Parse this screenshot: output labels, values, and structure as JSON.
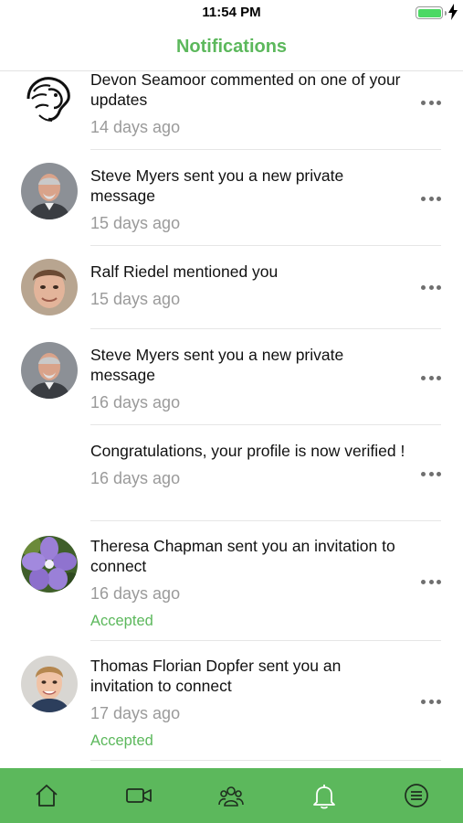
{
  "status_bar": {
    "time": "11:54 PM",
    "battery_level": 1.0
  },
  "header": {
    "title": "Notifications"
  },
  "notifications": [
    {
      "message": "Devon Seamoor commented on one of your updates",
      "time": "14 days ago",
      "status": "",
      "avatar": "lion-logo"
    },
    {
      "message": "Steve Myers sent you a new private message",
      "time": "15 days ago",
      "status": "",
      "avatar": "steve-photo"
    },
    {
      "message": "Ralf Riedel mentioned you",
      "time": "15 days ago",
      "status": "",
      "avatar": "ralf-photo"
    },
    {
      "message": "Steve Myers sent you a new private message",
      "time": "16 days ago",
      "status": "",
      "avatar": "steve-photo"
    },
    {
      "message": "Congratulations, your profile is now verified !",
      "time": "16 days ago",
      "status": "",
      "avatar": ""
    },
    {
      "message": "Theresa Chapman sent you an invitation to connect",
      "time": "16 days ago",
      "status": "Accepted",
      "avatar": "flower-photo"
    },
    {
      "message": "Thomas Florian Dopfer sent you an invitation to connect",
      "time": "17 days ago",
      "status": "Accepted",
      "avatar": "thomas-photo"
    }
  ],
  "tab_bar": {
    "icons": [
      "home-icon",
      "video-icon",
      "groups-icon",
      "bell-icon",
      "menu-list-icon"
    ],
    "active": "bell-icon"
  },
  "colors": {
    "accent": "#5cb85c",
    "muted": "#9a9a9a",
    "divider": "#e6e6e6"
  }
}
